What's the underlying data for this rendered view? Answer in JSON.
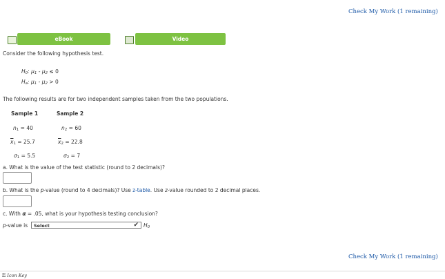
{
  "header": {
    "check_work": "Check My Work (1 remaining)"
  },
  "footer": {
    "check_work": "Check My Work (1 remaining)",
    "icon_key": "Icon Key"
  },
  "toolbar": {
    "ebook_label": "eBook",
    "video_label": "Video"
  },
  "intro": "Consider the following hypothesis test.",
  "hypotheses": {
    "h0_label": "H",
    "h0_sub": "0",
    "ha_label": "H",
    "ha_sub": "a",
    "mu": "μ",
    "h0_rest": "≤ 0",
    "ha_rest": "> 0"
  },
  "samples_intro": "The following results are for two independent samples taken from the two populations.",
  "samples": {
    "col1_header": "Sample 1",
    "col2_header": "Sample 2",
    "n1": "= 40",
    "n2": "= 60",
    "x1": "= 25.7",
    "x2": "= 22.8",
    "s1": "= 5.5",
    "s2": "= 7"
  },
  "questions": {
    "a": "a. What is the value of the test statistic (round to 2 decimals)?",
    "b_prefix": "b. What is the ",
    "b_pval": "p",
    "b_mid": "-value (round to 4 decimals)? Use ",
    "b_link": "z-table",
    "b_suffix": ". Use ",
    "b_z": "z",
    "b_end": "-value rounded to 2 decimal places.",
    "c_prefix": "c. With",
    "c_alpha": "α",
    "c_rest": "= .05, what is your hypothesis testing conclusion?",
    "pvalue_label_p": "p",
    "pvalue_label_rest": "-value is",
    "select_value": "Select",
    "h0_after": "H"
  }
}
